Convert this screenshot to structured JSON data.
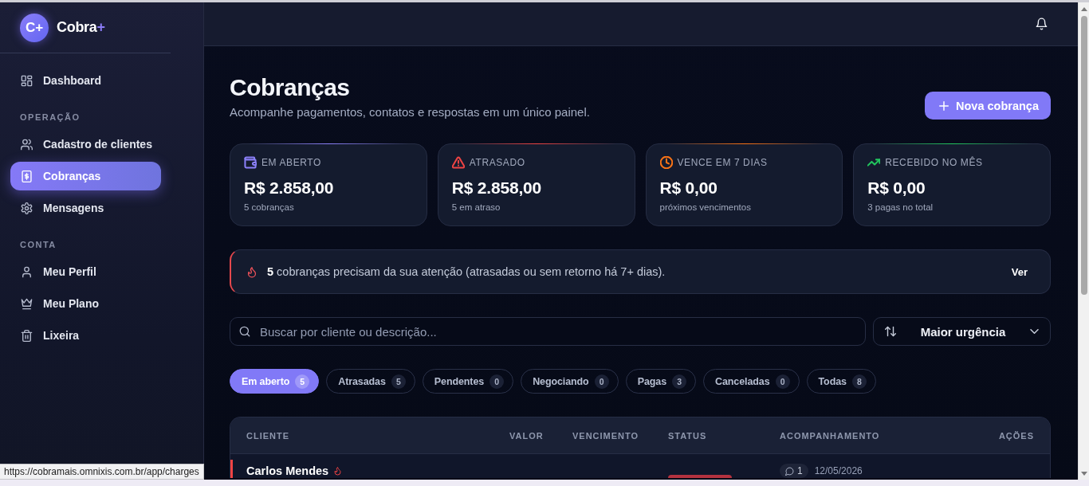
{
  "sidebar": {
    "brand": {
      "logo": "C+",
      "name": "Cobra",
      "accent": "+"
    },
    "sections": [
      {
        "items": [
          {
            "kind": "dashboard",
            "label": "Dashboard",
            "selected": false
          }
        ]
      },
      {
        "title": "OPERAÇÃO",
        "items": [
          {
            "kind": "clients",
            "label": "Cadastro de clientes",
            "selected": false
          },
          {
            "kind": "charges",
            "label": "Cobranças",
            "selected": true
          },
          {
            "kind": "messages",
            "label": "Mensagens",
            "selected": false
          }
        ]
      },
      {
        "title": "CONTA",
        "items": [
          {
            "kind": "profile",
            "label": "Meu Perfil",
            "selected": false
          },
          {
            "kind": "plan",
            "label": "Meu Plano",
            "selected": false
          },
          {
            "kind": "trash",
            "label": "Lixeira",
            "selected": false
          }
        ]
      }
    ]
  },
  "page": {
    "title": "Cobranças",
    "subtitle": "Acompanhe pagamentos, contatos e respostas em um único painel.",
    "new_button": "Nova cobrança"
  },
  "stats": [
    {
      "kind": "open",
      "label": "EM ABERTO",
      "value": "R$ 2.858,00",
      "caption": "5 cobranças",
      "color": "#8b80f9"
    },
    {
      "kind": "overdue",
      "label": "ATRASADO",
      "value": "R$ 2.858,00",
      "caption": "5 em atraso",
      "color": "#ef4444"
    },
    {
      "kind": "due_soon",
      "label": "VENCE EM 7 DIAS",
      "value": "R$ 0,00",
      "caption": "próximos vencimentos",
      "color": "#f97316"
    },
    {
      "kind": "received",
      "label": "RECEBIDO NO MÊS",
      "value": "R$ 0,00",
      "caption": "3 pagas no total",
      "color": "#22c55e"
    }
  ],
  "alert": {
    "message": "**5** cobranças precisam da sua atenção (atrasadas ou sem retorno há 7+ dias).",
    "action": "Ver"
  },
  "search": {
    "placeholder": "Buscar por cliente ou descrição..."
  },
  "sort": {
    "value": "Maior urgência"
  },
  "filters": [
    {
      "label": "Em aberto",
      "count": "5",
      "selected": true
    },
    {
      "label": "Atrasadas",
      "count": "5",
      "selected": false
    },
    {
      "label": "Pendentes",
      "count": "0",
      "selected": false
    },
    {
      "label": "Negociando",
      "count": "0",
      "selected": false
    },
    {
      "label": "Pagas",
      "count": "3",
      "selected": false
    },
    {
      "label": "Canceladas",
      "count": "0",
      "selected": false
    },
    {
      "label": "Todas",
      "count": "8",
      "selected": false
    }
  ],
  "table": {
    "columns": [
      "CLIENTE",
      "VALOR",
      "VENCIMENTO",
      "STATUS",
      "ACOMPANHAMENTO",
      "AÇÕES"
    ],
    "rows": [
      {
        "client": "Carlos Mendes",
        "urgent": true,
        "status": {
          "kind": "overdue"
        },
        "messages": "1",
        "last_contact": "12/05/2026"
      }
    ]
  },
  "status_url": "https://cobramais.omnixis.com.br/app/charges"
}
